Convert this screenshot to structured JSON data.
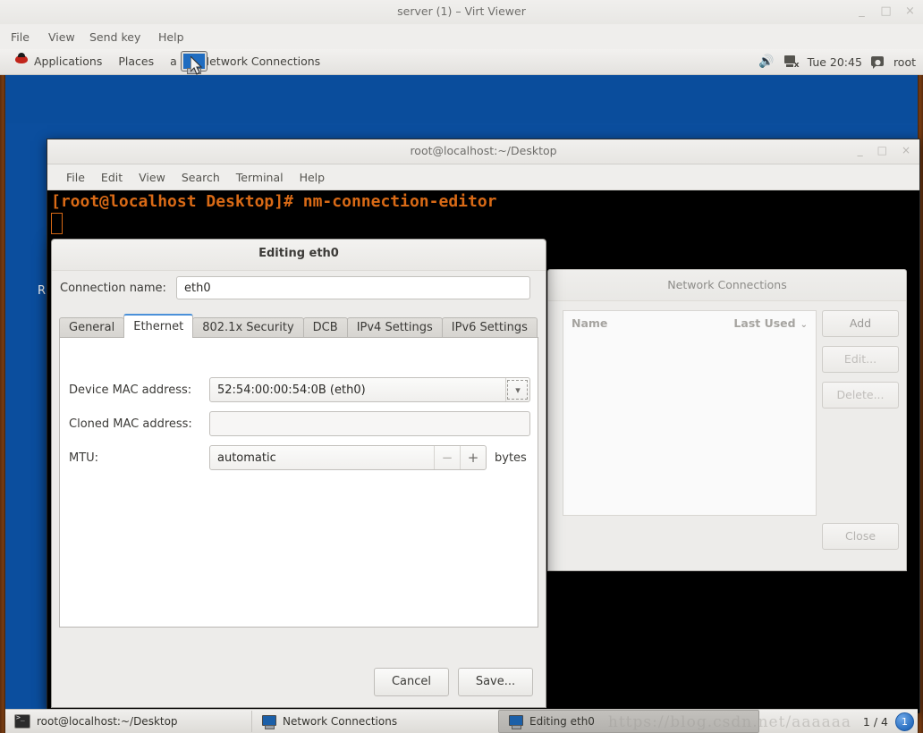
{
  "virt_viewer": {
    "title": "server (1) – Virt Viewer",
    "window_buttons": [
      "minimize",
      "maximize",
      "close"
    ],
    "window_button_glyphs": [
      "_",
      "□",
      "×"
    ],
    "menu": [
      "File",
      "View",
      "Send key",
      "Help"
    ]
  },
  "gnome_panel": {
    "applications": "Applications",
    "places": "Places",
    "window_title": "Network Connections",
    "obscured_item": "a",
    "clock": "Tue 20:45",
    "user": "root",
    "icons": [
      "redhat-logo-icon",
      "volume-icon",
      "network-disconnected-icon",
      "chat-icon"
    ]
  },
  "desktop": {
    "icon_label": "",
    "icon_name": "home-folder-icon",
    "partial_text": "RH"
  },
  "terminal": {
    "title": "root@localhost:~/Desktop",
    "menu": [
      "File",
      "Edit",
      "View",
      "Search",
      "Terminal",
      "Help"
    ],
    "window_button_glyphs": [
      "_",
      "□",
      "×"
    ],
    "prompt_line": "[root@localhost Desktop]# nm-connection-editor"
  },
  "network_connections": {
    "title": "Network Connections",
    "columns": [
      "Name",
      "Last Used"
    ],
    "sort_indicator": "⌄",
    "rows": [],
    "buttons": [
      {
        "label": "Add",
        "disabled": false
      },
      {
        "label": "Edit...",
        "disabled": true
      },
      {
        "label": "Delete...",
        "disabled": true
      }
    ],
    "close_label": "Close"
  },
  "editing_dialog": {
    "title": "Editing eth0",
    "connection_name_label": "Connection name:",
    "connection_name_value": "eth0",
    "tabs": [
      {
        "label": "General",
        "active": false
      },
      {
        "label": "Ethernet",
        "active": true
      },
      {
        "label": "802.1x Security",
        "active": false
      },
      {
        "label": "DCB",
        "active": false
      },
      {
        "label": "IPv4 Settings",
        "active": false
      },
      {
        "label": "IPv6 Settings",
        "active": false
      }
    ],
    "fields": {
      "device_mac_label": "Device MAC address:",
      "device_mac_value": "52:54:00:00:54:0B (eth0)",
      "cloned_mac_label": "Cloned MAC address:",
      "cloned_mac_value": "",
      "mtu_label": "MTU:",
      "mtu_value": "automatic",
      "mtu_unit": "bytes",
      "spin_minus": "−",
      "spin_plus": "+"
    },
    "buttons": {
      "cancel": "Cancel",
      "save": "Save..."
    }
  },
  "taskbar": {
    "items": [
      {
        "label": "root@localhost:~/Desktop",
        "icon": "terminal-icon",
        "active": false
      },
      {
        "label": "Network Connections",
        "icon": "network-window-icon",
        "active": false
      },
      {
        "label": "Editing eth0",
        "icon": "network-window-icon",
        "active": true
      }
    ],
    "pager": "1 / 4",
    "workspace": "1"
  },
  "watermark": "https://blog.csdn.net/aaaaaa",
  "colors": {
    "desktop_blue": "#0b4e9e",
    "terminal_orange": "#d96a16",
    "accent_blue": "#4a90d9",
    "panel_gray": "#efeeec"
  }
}
